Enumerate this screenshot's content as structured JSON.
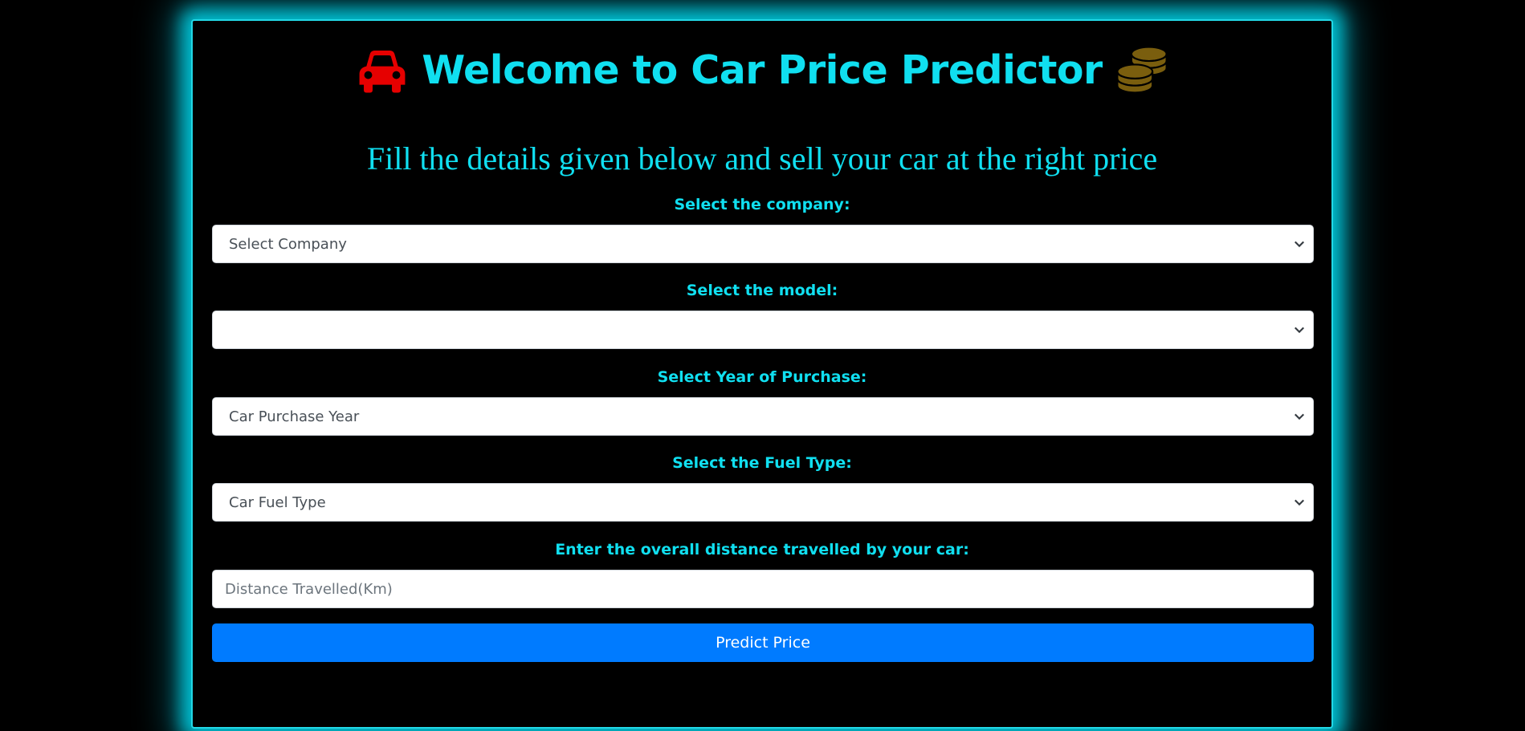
{
  "header": {
    "title": "Welcome to Car Price Predictor",
    "left_icon": "car-icon",
    "right_icon": "coins-icon",
    "subtitle": "Fill the details given below and sell your car at the right price"
  },
  "form": {
    "company_label": "Select the company:",
    "company_value": "Select Company",
    "model_label": "Select the model:",
    "model_value": "",
    "year_label": "Select Year of Purchase:",
    "year_value": "Car Purchase Year",
    "fuel_label": "Select the Fuel Type:",
    "fuel_value": "Car Fuel Type",
    "distance_label": "Enter the overall distance travelled by your car:",
    "distance_placeholder": "Distance Travelled(Km)",
    "submit_label": "Predict Price"
  },
  "colors": {
    "accent": "#10dff0",
    "glow": "#22d8e6",
    "button": "#007bff",
    "car_icon": "#e60000",
    "coins_icon": "#7a5e0e"
  }
}
